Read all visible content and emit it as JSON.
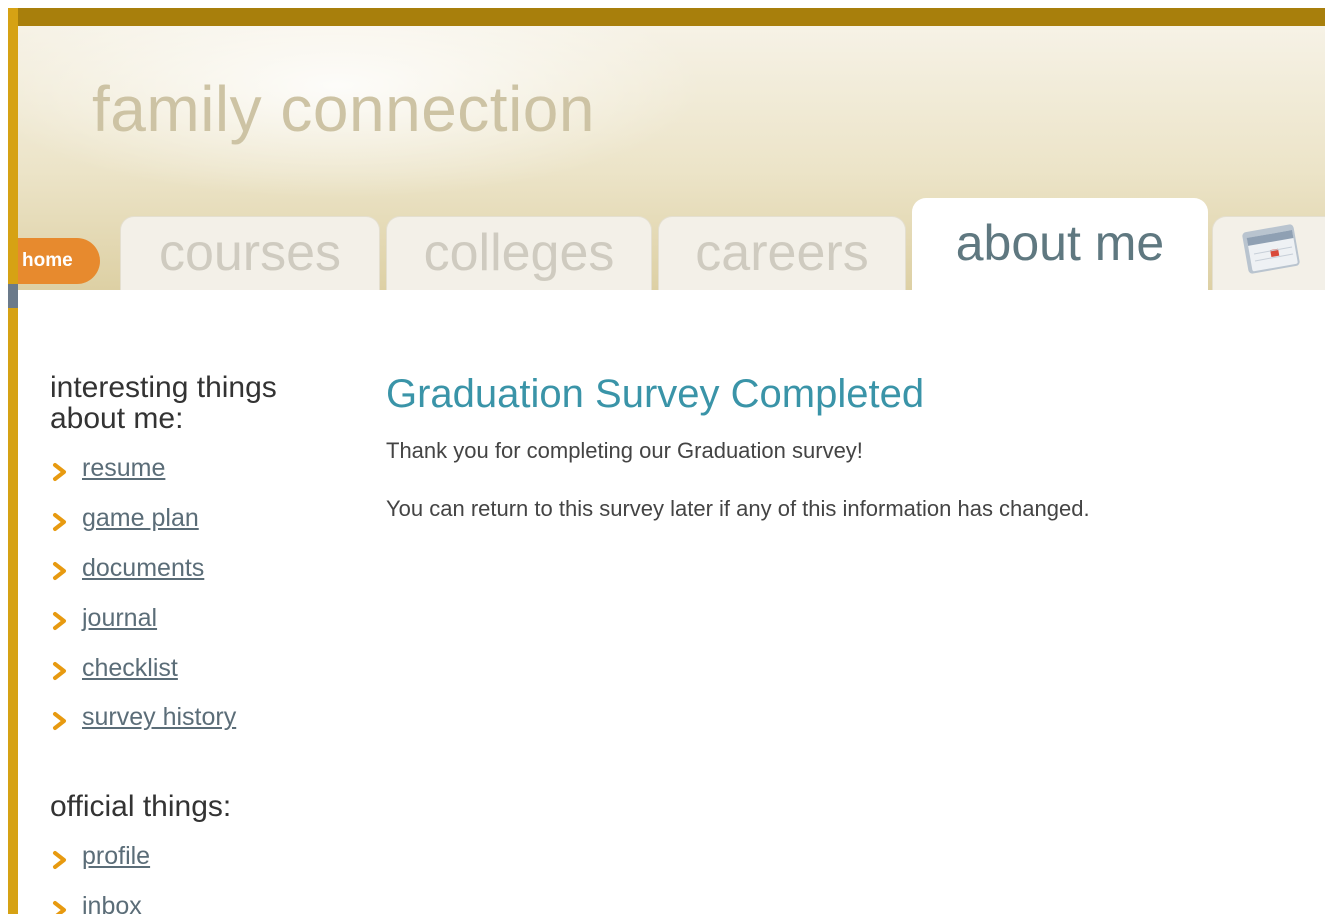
{
  "header": {
    "site_title": "family connection"
  },
  "nav": {
    "home_label": "home",
    "tabs": [
      {
        "label": "courses",
        "active": false
      },
      {
        "label": "colleges",
        "active": false
      },
      {
        "label": "careers",
        "active": false
      },
      {
        "label": "about me",
        "active": true
      }
    ],
    "next_tab_icon": "calendar-icon"
  },
  "sidebar": {
    "interesting_heading_line1": "interesting things",
    "interesting_heading_line2": "about me:",
    "interesting_items": [
      {
        "label": "resume"
      },
      {
        "label": "game plan"
      },
      {
        "label": "documents"
      },
      {
        "label": "journal"
      },
      {
        "label": "checklist"
      },
      {
        "label": "survey history"
      }
    ],
    "official_heading": "official things:",
    "official_items": [
      {
        "label": "profile"
      },
      {
        "label": "inbox"
      }
    ]
  },
  "main": {
    "title": "Graduation Survey Completed",
    "thanks_text": "Thank you for completing our Graduation survey!",
    "return_text": "You can return to this survey later if any of this information has changed."
  },
  "colors": {
    "accent_orange": "#e78a2e",
    "frame_gold": "#d6a214",
    "title_teal": "#3a94a8",
    "chevron": "#e79a10"
  }
}
